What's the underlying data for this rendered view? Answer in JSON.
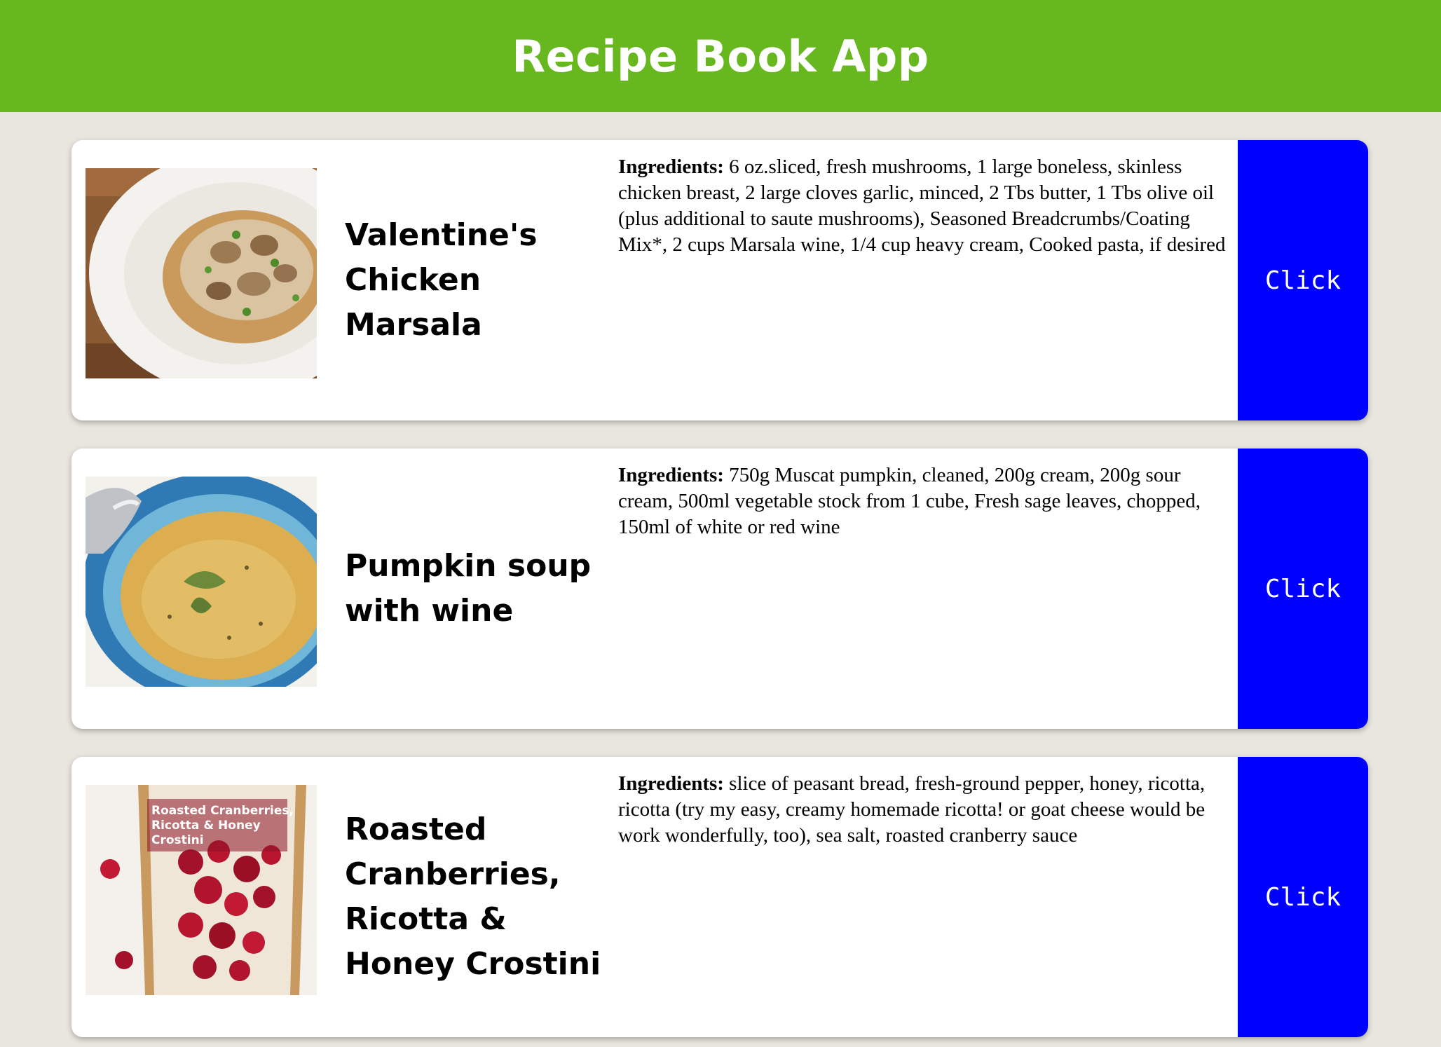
{
  "app": {
    "title": "Recipe Book App",
    "header_color": "#67b81f",
    "background_color": "#e9e6dd"
  },
  "button": {
    "color": "#0000ff"
  },
  "recipes": [
    {
      "name_lines": [
        "Valentine's",
        "Chicken",
        "Marsala"
      ],
      "image": "chicken-marsala-photo",
      "ingredients_label": "Ingredients:",
      "ingredients": "6 oz.sliced, fresh mushrooms, 1 large boneless, skinless chicken breast, 2 large cloves garlic, minced, 2 Tbs butter, 1 Tbs olive oil (plus additional to saute mushrooms), Seasoned Breadcrumbs/Coating Mix*, 2 cups Marsala wine, 1/4 cup heavy cream, Cooked pasta, if desired",
      "button_label": "Click"
    },
    {
      "name_lines": [
        "Pumpkin soup",
        "with wine"
      ],
      "image": "pumpkin-soup-photo",
      "ingredients_label": "Ingredients:",
      "ingredients": "750g Muscat pumpkin, cleaned, 200g cream, 200g sour cream, 500ml vegetable stock from 1 cube, Fresh sage leaves, chopped, 150ml of white or red wine",
      "button_label": "Click"
    },
    {
      "name_lines": [
        "Roasted",
        "Cranberries,",
        "Ricotta &",
        "Honey Crostini"
      ],
      "image": "cranberry-crostini-photo",
      "image_text": [
        "Roasted Cranberries,",
        "Ricotta & Honey",
        "Crostini"
      ],
      "ingredients_label": "Ingredients:",
      "ingredients": "slice of peasant bread, fresh-ground pepper, honey, ricotta, ricotta (try my easy, creamy homemade ricotta! or goat cheese would be work wonderfully, too), sea salt, roasted cranberry sauce",
      "button_label": "Click"
    }
  ]
}
